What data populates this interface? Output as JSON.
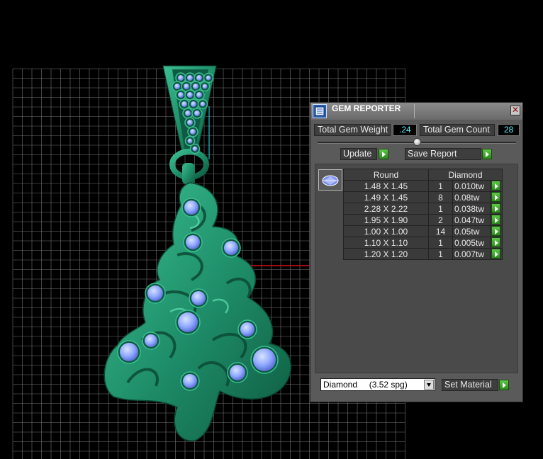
{
  "panel": {
    "title": "GEM REPORTER",
    "close_icon": "close-icon",
    "total_weight_label": "Total Gem Weight",
    "total_weight_value": ".24",
    "total_count_label": "Total Gem Count",
    "total_count_value": "28",
    "update_label": "Update",
    "save_report_label": "Save Report",
    "table_headers": [
      "Round",
      "Diamond"
    ],
    "rows": [
      {
        "size": "1.48 X 1.45",
        "qty": "1",
        "weight": "0.010tw"
      },
      {
        "size": "1.49 X 1.45",
        "qty": "8",
        "weight": "0.08tw"
      },
      {
        "size": "2.28 X 2.22",
        "qty": "1",
        "weight": "0.038tw"
      },
      {
        "size": "1.95 X 1.90",
        "qty": "2",
        "weight": "0.047tw"
      },
      {
        "size": "1.00 X 1.00",
        "qty": "14",
        "weight": "0.05tw"
      },
      {
        "size": "1.10 X 1.10",
        "qty": "1",
        "weight": "0.005tw"
      },
      {
        "size": "1.20 X 1.20",
        "qty": "1",
        "weight": "0.007tw"
      }
    ],
    "material_selected": "Diamond     (3.52 spg)",
    "set_material_label": "Set Material"
  },
  "colors": {
    "metal": "#1f8f6a",
    "gem": "#8fa8ff",
    "grid": "#9a9a9a",
    "value_text": "#5ff2ff"
  }
}
